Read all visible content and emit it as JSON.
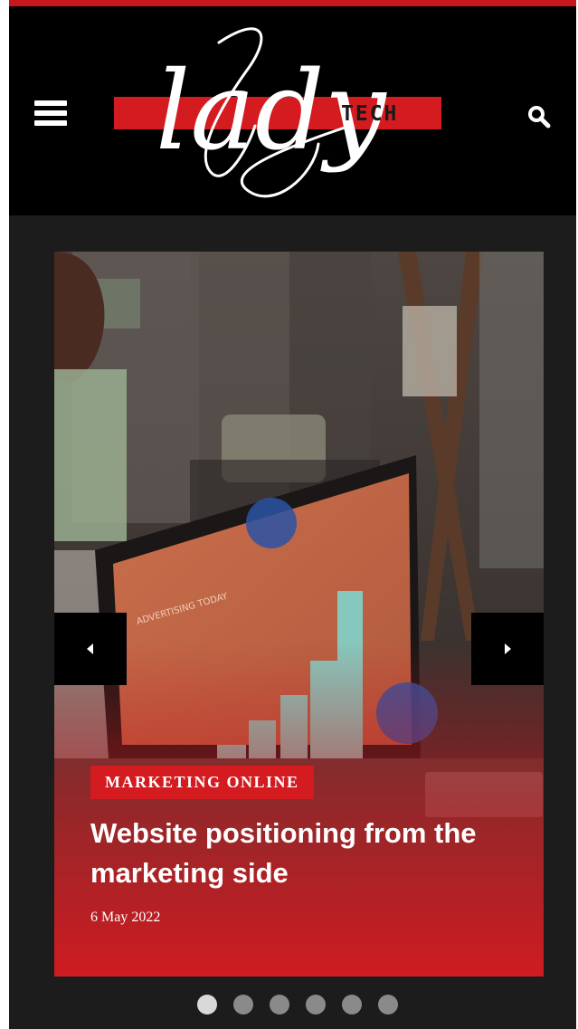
{
  "header": {
    "menu_icon": "hamburger-menu-icon",
    "logo_script": "lady",
    "logo_sub": "TECH",
    "search_icon": "search-icon"
  },
  "colors": {
    "accent": "#d31b20",
    "header_bg": "#000000",
    "page_bg": "#1c1c1c",
    "dot_active": "#d9d9d9",
    "dot_inactive": "#8a8a8a"
  },
  "slider": {
    "prev_icon": "caret-left-icon",
    "next_icon": "caret-right-icon",
    "slide": {
      "category": "MARKETING ONLINE",
      "title": "Website positioning from the marketing side",
      "date": "6 May 2022",
      "screen_text": "ADVERTISING TODAY"
    },
    "dots": {
      "count": 6,
      "active": 0
    }
  }
}
